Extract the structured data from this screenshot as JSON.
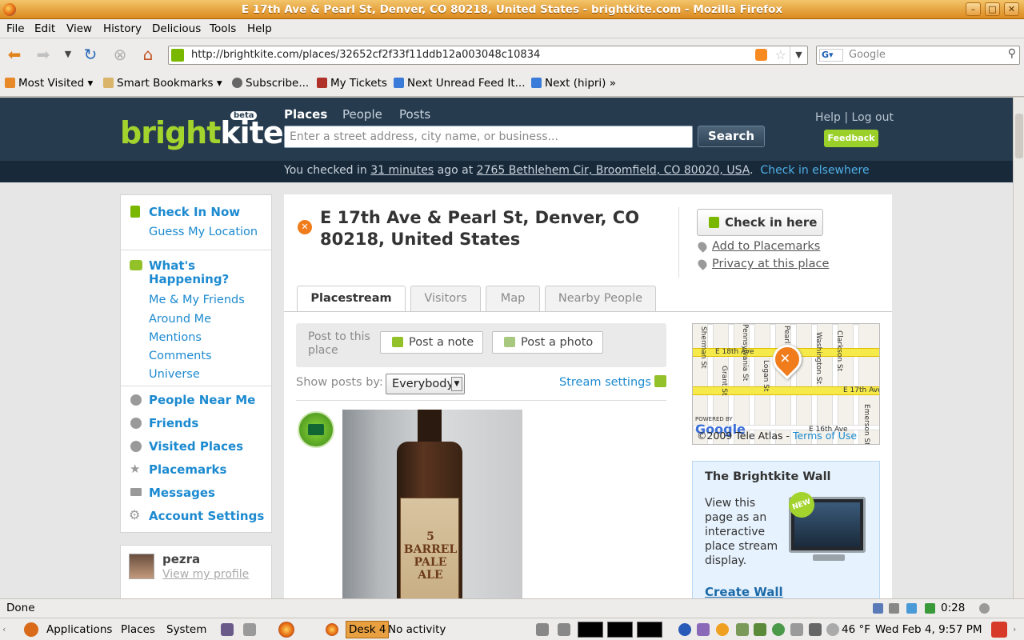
{
  "window": {
    "title": "E 17th Ave & Pearl St, Denver, CO 80218, United States - brightkite.com - Mozilla Firefox"
  },
  "menubar": [
    "File",
    "Edit",
    "View",
    "History",
    "Delicious",
    "Tools",
    "Help"
  ],
  "navbar": {
    "url": "http://brightkite.com/places/32652cf2f33f11ddb12a003048c10834",
    "search_placeholder": "Google"
  },
  "bookmarks": [
    {
      "label": "Most Visited",
      "has_menu": true
    },
    {
      "label": "Smart Bookmarks",
      "has_menu": true
    },
    {
      "label": "Subscribe...",
      "has_menu": false
    },
    {
      "label": "My Tickets",
      "has_menu": false
    },
    {
      "label": "Next Unread Feed It...",
      "has_menu": false
    },
    {
      "label": "Next (hipri) »",
      "has_menu": false
    }
  ],
  "site": {
    "logo_a": "bright",
    "logo_b": "kite",
    "beta": "beta",
    "tabs": [
      "Places",
      "People",
      "Posts"
    ],
    "search_placeholder": "Enter a street address, city name, or business...",
    "search_button": "Search",
    "help": "Help",
    "sep": "|",
    "logout": "Log out",
    "feedback": "Feedback",
    "checkin": {
      "prefix": "You checked in",
      "ago": "31 minutes",
      "mid": "ago at",
      "address": "2765 Bethlehem Cir, Broomfield, CO 80020, USA",
      "dot": ".",
      "elsewhere": "Check in elsewhere"
    }
  },
  "sidebar": {
    "checkin_now": "Check In Now",
    "guess_location": "Guess My Location",
    "whats_happening": "What's Happening?",
    "feeds": [
      "Me & My Friends",
      "Around Me",
      "Mentions",
      "Comments",
      "Universe"
    ],
    "nav": [
      "People Near Me",
      "Friends",
      "Visited Places",
      "Placemarks",
      "Messages",
      "Account Settings"
    ]
  },
  "profile": {
    "username": "pezra",
    "link": "View my profile"
  },
  "place": {
    "title": "E 17th Ave & Pearl St, Denver, CO 80218, United States",
    "check_in_here": "Check in here",
    "add_placemarks": "Add to Placemarks",
    "privacy": "Privacy at this place",
    "tabs": [
      "Placestream",
      "Visitors",
      "Map",
      "Nearby People"
    ],
    "post_to": "Post to this place",
    "post_note": "Post a note",
    "post_photo": "Post a photo",
    "show_posts_by": "Show posts by:",
    "show_select": "Everybody",
    "stream_settings": "Stream settings",
    "photo_label_text": "5 BARREL PALE ALE"
  },
  "map": {
    "streets_h": [
      "E 18th Ave",
      "E 17th Ave",
      "E 16th Ave"
    ],
    "streets_v": [
      "Sherman St",
      "Grant St",
      "Pennsylvania St",
      "Logan St",
      "Pearl St",
      "Washington St",
      "Clarkson St",
      "Emerson St"
    ],
    "powered": "POWERED BY",
    "logo": "Google",
    "copyright": "©2009 Tele Atlas - ",
    "terms": "Terms of Use"
  },
  "wall": {
    "title": "The Brightkite Wall",
    "text": "View this page as an interactive place stream display.",
    "badge": "NEW",
    "link": "Create Wall"
  },
  "statusbar": {
    "status": "Done",
    "time": "0:28"
  },
  "taskbar": {
    "applications": "Applications",
    "places": "Places",
    "system": "System",
    "desk": "Desk 4",
    "activity": "No activity",
    "temp": "46 °F",
    "clock": "Wed Feb  4,  9:57 PM"
  }
}
